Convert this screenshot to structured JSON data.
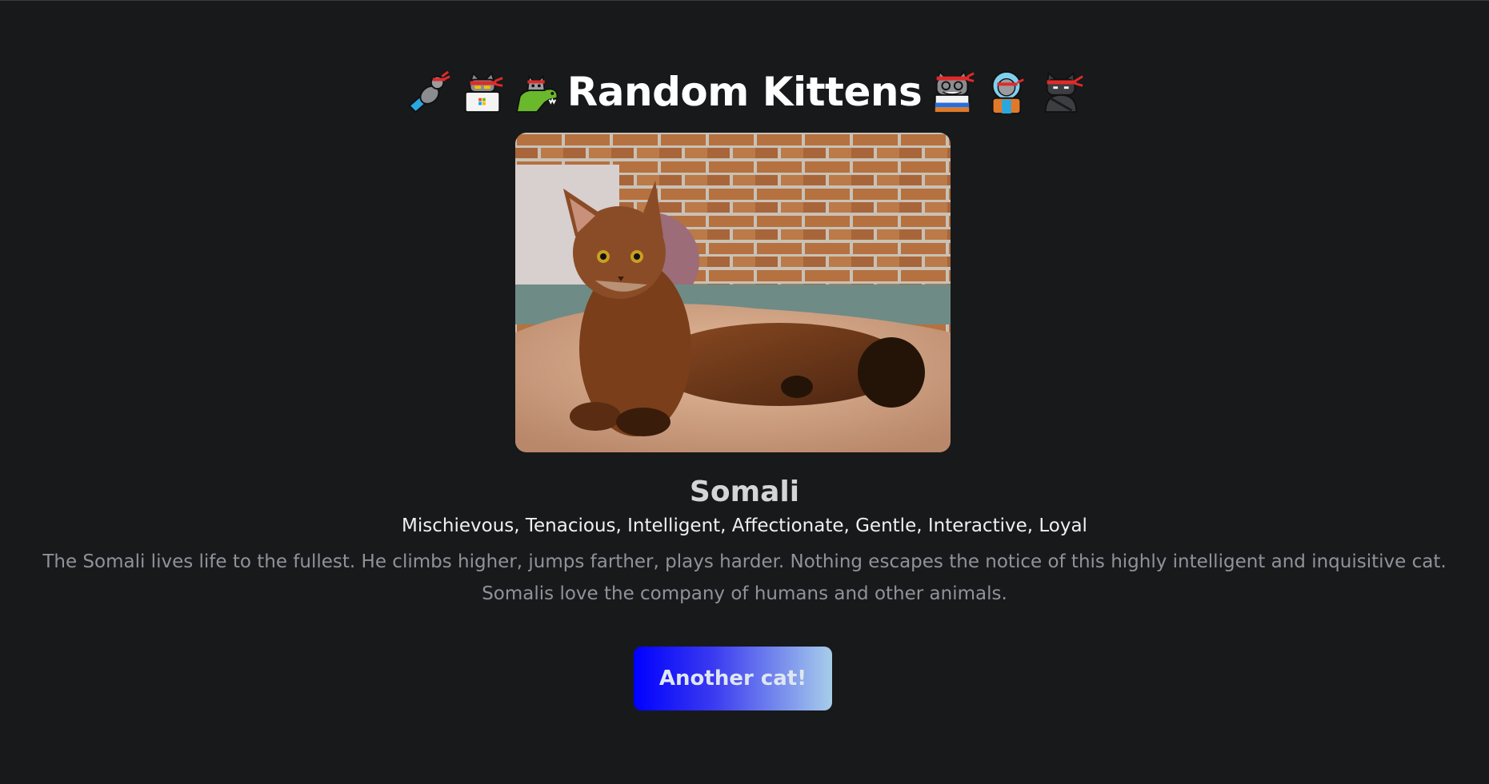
{
  "header": {
    "title": "Random Kittens",
    "left_icons": [
      "rocket-ninja-cat-icon",
      "hacker-ninja-cat-icon",
      "dino-ninja-cat-icon"
    ],
    "right_icons": [
      "hipster-ninja-cat-icon",
      "astronaut-ninja-cat-icon",
      "ninja-cat-icon"
    ]
  },
  "cat": {
    "breed": "Somali",
    "temperament": "Mischievous, Tenacious, Intelligent, Affectionate, Gentle, Interactive, Loyal",
    "description": "The Somali lives life to the fullest. He climbs higher, jumps farther, plays harder. Nothing escapes the notice of this highly intelligent and inquisitive cat. Somalis love the company of humans and other animals."
  },
  "actions": {
    "another_label": "Another cat!"
  },
  "colors": {
    "background": "#18191b",
    "button_gradient_start": "#0000ff",
    "button_gradient_end": "#a7cdea"
  }
}
